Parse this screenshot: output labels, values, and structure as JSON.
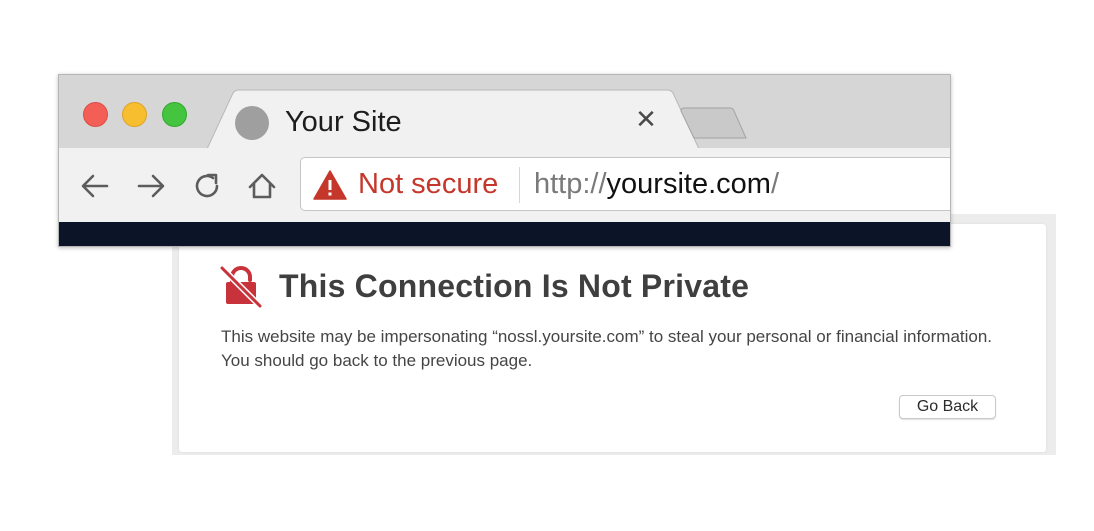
{
  "browser": {
    "window_controls": {
      "close_color": "#f35e57",
      "minimize_color": "#f7be2f",
      "zoom_color": "#45c43f"
    },
    "tab": {
      "title": "Your Site",
      "favicon": "gray-circle-icon",
      "close_icon": "close-icon"
    },
    "new_tab": "new-tab-button",
    "nav": {
      "back_icon": "back-arrow-icon",
      "forward_icon": "forward-arrow-icon",
      "reload_icon": "reload-icon",
      "home_icon": "home-icon"
    },
    "address_bar": {
      "security_icon": "warning-triangle-icon",
      "security_label": "Not secure",
      "security_color": "#c5372b",
      "url_scheme": "http://",
      "url_host": "yoursite.com",
      "url_path": "/"
    }
  },
  "error_panel": {
    "icon": "broken-lock-icon",
    "icon_color": "#c8323b",
    "title": "This Connection Is Not Private",
    "body_prefix": "This website may be impersonating ",
    "body_domain": "“nossl.yoursite.com”",
    "body_suffix": " to steal your personal or financial information. You should go back to the previous page.",
    "go_back_label": "Go Back"
  }
}
